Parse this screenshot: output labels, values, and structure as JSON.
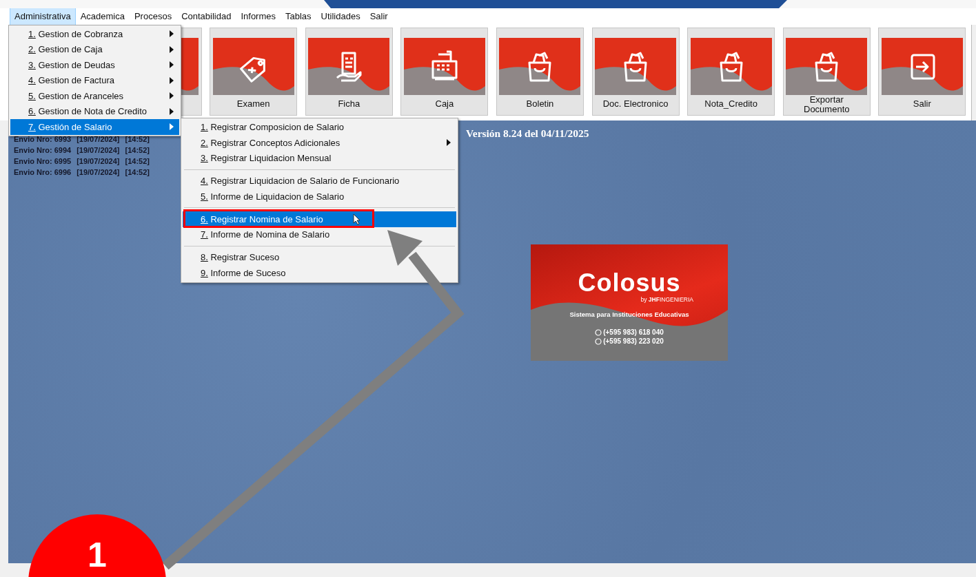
{
  "menu_bar": [
    {
      "label": "Administrativa",
      "selected": true
    },
    {
      "label": "Academica",
      "selected": false
    },
    {
      "label": "Procesos",
      "selected": false
    },
    {
      "label": "Contabilidad",
      "selected": false
    },
    {
      "label": "Informes",
      "selected": false
    },
    {
      "label": "Tablas",
      "selected": false
    },
    {
      "label": "Utilidades",
      "selected": false
    },
    {
      "label": "Salir",
      "selected": false
    }
  ],
  "toolbar": [
    {
      "label": "Examen",
      "kind": "tag"
    },
    {
      "label": "Ficha",
      "kind": "receipt"
    },
    {
      "label": "Caja",
      "kind": "register"
    },
    {
      "label": "Boletin",
      "kind": "bag"
    },
    {
      "label": "Doc. Electronico",
      "kind": "bag"
    },
    {
      "label": "Nota_Credito",
      "kind": "bag"
    },
    {
      "label": "Exportar Documento",
      "kind": "bag"
    },
    {
      "label": "Salir",
      "kind": "exit"
    }
  ],
  "dropdown": [
    {
      "label": "1. Gestion de Cobranza",
      "selected": false,
      "submenu": true
    },
    {
      "label": "2. Gestion de Caja",
      "selected": false,
      "submenu": true
    },
    {
      "label": "3. Gestion de Deudas",
      "selected": false,
      "submenu": true
    },
    {
      "label": "4. Gestion de Factura",
      "selected": false,
      "submenu": true
    },
    {
      "label": "5. Gestion de Aranceles",
      "selected": false,
      "submenu": true
    },
    {
      "label": "6. Gestion de Nota de Credito",
      "selected": false,
      "submenu": true
    },
    {
      "label": "7. Gestión de Salario",
      "selected": true,
      "submenu": true
    }
  ],
  "submenu": {
    "groups": [
      [
        {
          "label": "1. Registrar Composicion de Salario",
          "selected": false,
          "submenu": false
        },
        {
          "label": "2. Registrar Conceptos Adicionales",
          "selected": false,
          "submenu": true
        },
        {
          "label": "3. Registrar Liquidacion Mensual",
          "selected": false,
          "submenu": false
        }
      ],
      [
        {
          "label": "4. Registrar Liquidacion de Salario de Funcionario",
          "selected": false,
          "submenu": false
        },
        {
          "label": "5. Informe de Liquidacion de Salario",
          "selected": false,
          "submenu": false
        }
      ],
      [
        {
          "label": "6. Registrar Nomina de Salario",
          "selected": true,
          "submenu": false
        },
        {
          "label": "7. Informe de Nomina de Salario",
          "selected": false,
          "submenu": false
        }
      ],
      [
        {
          "label": "8. Registrar Suceso",
          "selected": false,
          "submenu": false
        },
        {
          "label": "9. Informe de Suceso",
          "selected": false,
          "submenu": false
        }
      ]
    ]
  },
  "messages": [
    {
      "number": "Envio Nro: 6993",
      "date": "[19/07/2024]",
      "time": "[14:52]"
    },
    {
      "number": "Envio Nro: 6994",
      "date": "[19/07/2024]",
      "time": "[14:52]"
    },
    {
      "number": "Envio Nro: 6995",
      "date": "[19/07/2024]",
      "time": "[14:52]"
    },
    {
      "number": "Envio Nro: 6996",
      "date": "[19/07/2024]",
      "time": "[14:52]"
    }
  ],
  "version": "Versión 8.24 del 04/11/2025",
  "logo_card": {
    "brand": "Colosus",
    "byline": "by **JHF**INGENIERIA",
    "tagline": "Sistema para Instituciones Educativas",
    "phones": [
      "(+595 983) 618 040",
      "(+595 983) 223 020"
    ]
  },
  "step_badge": "1"
}
